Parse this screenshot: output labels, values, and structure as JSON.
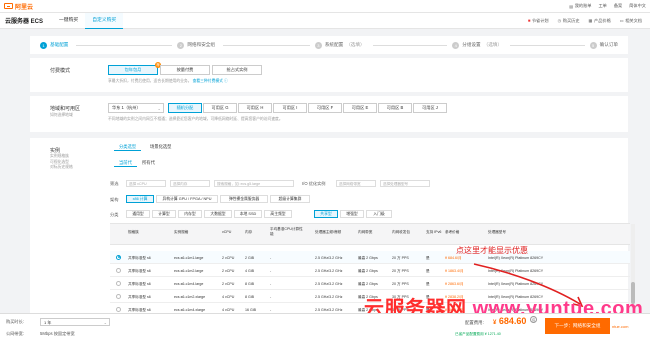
{
  "topbar": {
    "logo_text": "阿里云",
    "items": [
      "我的账单",
      "工单",
      "备案",
      "简体中文"
    ]
  },
  "header": {
    "product_name": "云服务器 ECS",
    "tabs": [
      "一键购买",
      "自定义购买"
    ],
    "active_tab": 1,
    "right_links": [
      "节省计划",
      "购买历史",
      "产品价格",
      "相关文档"
    ]
  },
  "steps": [
    {
      "num": "1",
      "label": "基础配置",
      "optional": ""
    },
    {
      "num": "2",
      "label": "网络和安全组",
      "optional": ""
    },
    {
      "num": "3",
      "label": "系统配置",
      "optional": "（选填）"
    },
    {
      "num": "4",
      "label": "分组设置",
      "optional": "（选填）"
    },
    {
      "num": "5",
      "label": "确认订单",
      "optional": ""
    }
  ],
  "billing": {
    "label": "付费模式",
    "options": [
      "包年包月",
      "按量付费",
      "抢占式实例"
    ],
    "active": 0,
    "recommend_badge": "荐",
    "hint": "享最大折扣，付费后使用，适合长期使用的业务。",
    "hint_link": "查看三种付费模式"
  },
  "region": {
    "label": "地域和可用区",
    "sublabel": "如何选择地域",
    "select_value": "华东 1（杭州）",
    "zones": [
      "随机分配",
      "可用区 G",
      "可用区 H",
      "可用区 I",
      "可用区 F",
      "可用区 E",
      "可用区 B",
      "可用区 J"
    ],
    "active": 0,
    "hint": "不同地域的实例之间内网互不相通；选择靠近您客户的地域，可降低网络时延、提高您客户的访问速度。"
  },
  "instance": {
    "label": "实例",
    "sublabels": [
      "实例规格族",
      "可视化选型",
      "对标历史规格"
    ],
    "tabs": [
      "分类选型",
      "场景化选型"
    ],
    "gen_tabs": [
      "当前代",
      "所有代"
    ],
    "filters": [
      {
        "label": "筛选",
        "placeholder": "选择 vCPU"
      },
      {
        "label": "",
        "placeholder": "选择内存"
      },
      {
        "label": "",
        "placeholder": "搜索规格，如: ecs.g5.large"
      },
      {
        "label": "I/O 优化实例",
        "placeholder": "选择网络带宽"
      },
      {
        "label": "",
        "placeholder": "选择处理器型号"
      }
    ],
    "arch_label": "架构",
    "arch_options": [
      "x86 计算",
      "异构计算 GPU / FPGA / NPU",
      "弹性裸金属服务器",
      "超级计算集群"
    ],
    "cat_label": "分类",
    "categories": [
      "通用型",
      "计算型",
      "内存型",
      "大数据型",
      "本地 SSD",
      "高主频型",
      "共享型",
      "增强型",
      "入门级"
    ],
    "active_category": 6
  },
  "table": {
    "headers": [
      "规格族",
      "实例规格",
      "vCPU",
      "内存",
      "平均基准CPU计算性能",
      "处理器主频/睿频",
      "内网带宽",
      "内网收发包",
      "支持 IPv6",
      "参考价格",
      "处理器型号"
    ],
    "rows": [
      {
        "family": "共享标准型 s6",
        "spec": "ecs.s6-c1m1.large",
        "vcpu": "2 vCPU",
        "mem": "2 GiB",
        "baseline": "-",
        "freq": "2.5 GHz/3.2 GHz",
        "bw": "最高 2 Gbps",
        "pps": "20 万 PPS",
        "ipv6": "是",
        "price": "¥ 684.6/月",
        "cpu": "Intel(R) Xeon(R) Platinum 8269CY",
        "selected": true
      },
      {
        "family": "共享标准型 s6",
        "spec": "ecs.s6-c1m2.large",
        "vcpu": "2 vCPU",
        "mem": "4 GiB",
        "baseline": "-",
        "freq": "2.5 GHz/3.2 GHz",
        "bw": "最高 2 Gbps",
        "pps": "20 万 PPS",
        "ipv6": "是",
        "price": "¥ 1863.4/月",
        "cpu": "Intel(R) Xeon(R) Platinum 8269CY",
        "selected": false
      },
      {
        "family": "共享标准型 s6",
        "spec": "ecs.s6-c1m4.large",
        "vcpu": "2 vCPU",
        "mem": "8 GiB",
        "baseline": "-",
        "freq": "2.5 GHz/3.2 GHz",
        "bw": "最高 2 Gbps",
        "pps": "20 万 PPS",
        "ipv6": "是",
        "price": "¥ 2863.6/月",
        "cpu": "Intel(R) Xeon(R) Platinum 8269CY",
        "selected": false
      },
      {
        "family": "共享标准型 s6",
        "spec": "ecs.s6-c1m2.xlarge",
        "vcpu": "4 vCPU",
        "mem": "8 GiB",
        "baseline": "-",
        "freq": "2.5 GHz/3.2 GHz",
        "bw": "最高 2 Gbps",
        "pps": "30 万 PPS",
        "ipv6": "是",
        "price": "¥ 2838.2/月",
        "cpu": "Intel(R) Xeon(R) Platinum 8269CY",
        "selected": false
      },
      {
        "family": "共享标准型 s6",
        "spec": "ecs.s6-c1m4.xlarge",
        "vcpu": "4 vCPU",
        "mem": "16 GiB",
        "baseline": "-",
        "freq": "2.5 GHz/3.2 GHz",
        "bw": "最高 2 Gbps",
        "pps": "30 万 PPS",
        "ipv6": "是",
        "price": "¥ 3823.2/月",
        "cpu": "Intel(R) Xeon(R) Platinum 8269CY",
        "selected": false
      }
    ]
  },
  "annotation": "点这里才能显示优惠",
  "watermark": {
    "cn": "云服务器网",
    "url": "www.yuntue.com"
  },
  "footer": {
    "duration_label": "购买时长:",
    "duration_value": "1 年",
    "bandwidth_label": "公网带宽:",
    "bandwidth_value": "5Mbps 按固定带宽",
    "config_label": "配置费用:",
    "currency": "¥",
    "price": "684.60",
    "price_unit": "省",
    "note": "已省产品配置费用 ¥ 1271.40",
    "cta": "下一步：网络和安全组",
    "ext": "ntue.com"
  },
  "colors": {
    "brand": "#ff6a00",
    "accent": "#00a1d6"
  }
}
